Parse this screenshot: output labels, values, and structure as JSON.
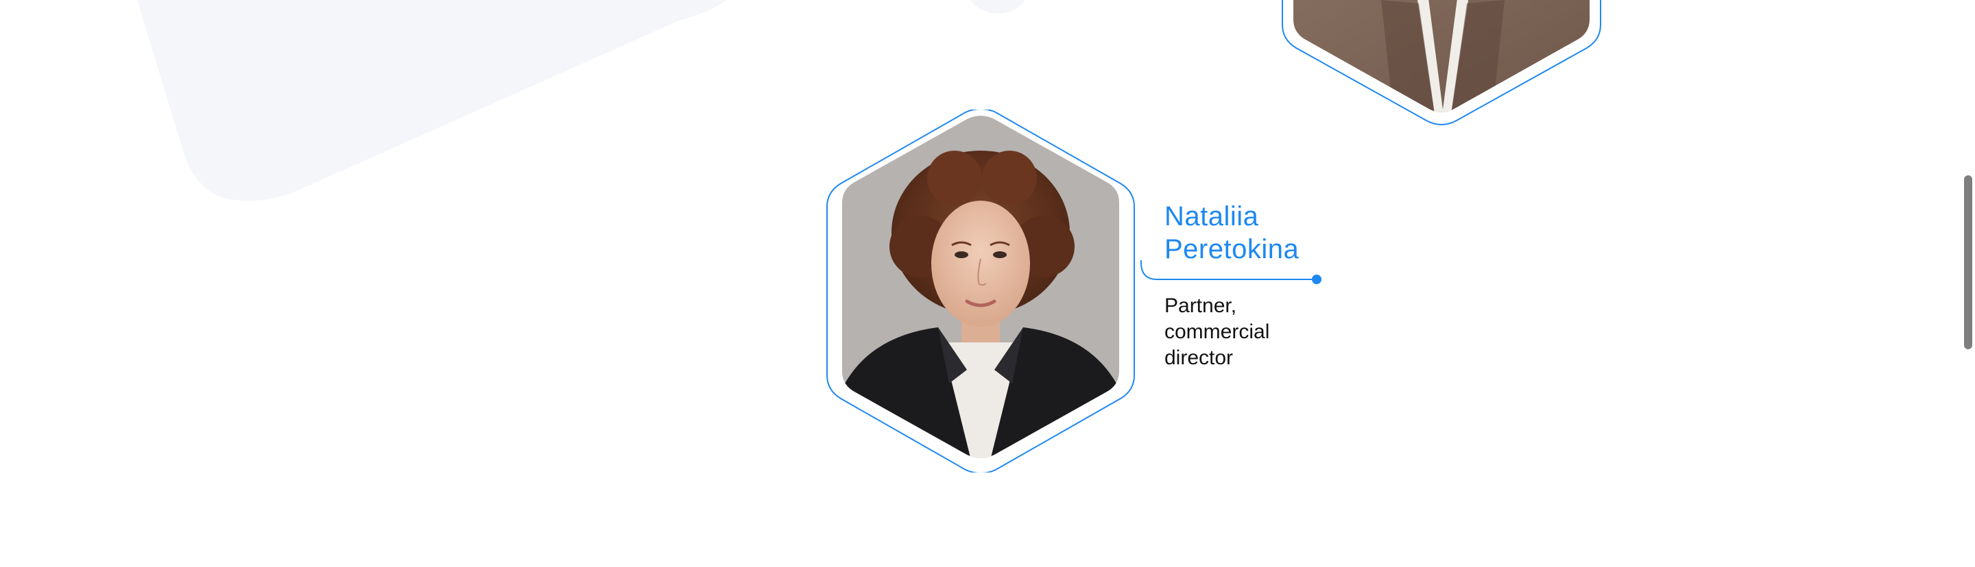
{
  "team_member": {
    "first_name": "Nataliia",
    "last_name": "Peretokina",
    "role_lines": [
      "Partner,",
      "commercial",
      "director"
    ]
  },
  "colors": {
    "accent": "#1e88f0",
    "text": "#111111",
    "bg_shape": "#f4f6fa",
    "scrollbar_thumb": "#7e7e7e"
  },
  "icons": {
    "connector": "connector-line-dot-icon"
  }
}
